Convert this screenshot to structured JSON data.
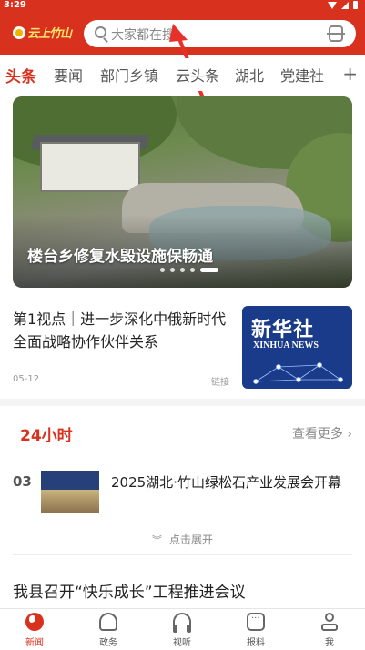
{
  "status_bar": {
    "time": "3:29"
  },
  "header": {
    "logo_text": "云上竹山",
    "search_placeholder": "大家都在搜",
    "brand_color": "#d8321e"
  },
  "tabs": [
    {
      "label": "头条",
      "active": true
    },
    {
      "label": "要闻",
      "active": false
    },
    {
      "label": "部门乡镇",
      "active": false
    },
    {
      "label": "云头条",
      "active": false
    },
    {
      "label": "湖北",
      "active": false
    },
    {
      "label": "党建社",
      "active": false
    }
  ],
  "tabs_more_icon": "plus-icon",
  "banner": {
    "caption": "楼台乡修复水毁设施保畅通",
    "slide_count": 5,
    "active_slide": 5
  },
  "feature_news": {
    "title": "第1视点｜进一步深化中俄新时代全面战略协作伙伴关系",
    "date": "05-12",
    "tag": "链接",
    "thumb_brand_cn": "新华社",
    "thumb_brand_en": "XINHUA NEWS"
  },
  "section_24h": {
    "title": "24小时",
    "see_more": "查看更多",
    "items": [
      {
        "rank": "03",
        "title": "2025湖北·竹山绿松石产业发展会开幕"
      }
    ],
    "expand_label": "点击展开"
  },
  "news_list": [
    {
      "title": "我县召开“快乐成长”工程推进会议"
    }
  ],
  "bottom_nav": [
    {
      "label": "新闻",
      "icon": "globe-icon",
      "active": true
    },
    {
      "label": "政务",
      "icon": "government-icon",
      "active": false
    },
    {
      "label": "视听",
      "icon": "headphones-icon",
      "active": false
    },
    {
      "label": "报料",
      "icon": "report-icon",
      "active": false
    },
    {
      "label": "我",
      "icon": "user-icon",
      "active": false
    }
  ]
}
